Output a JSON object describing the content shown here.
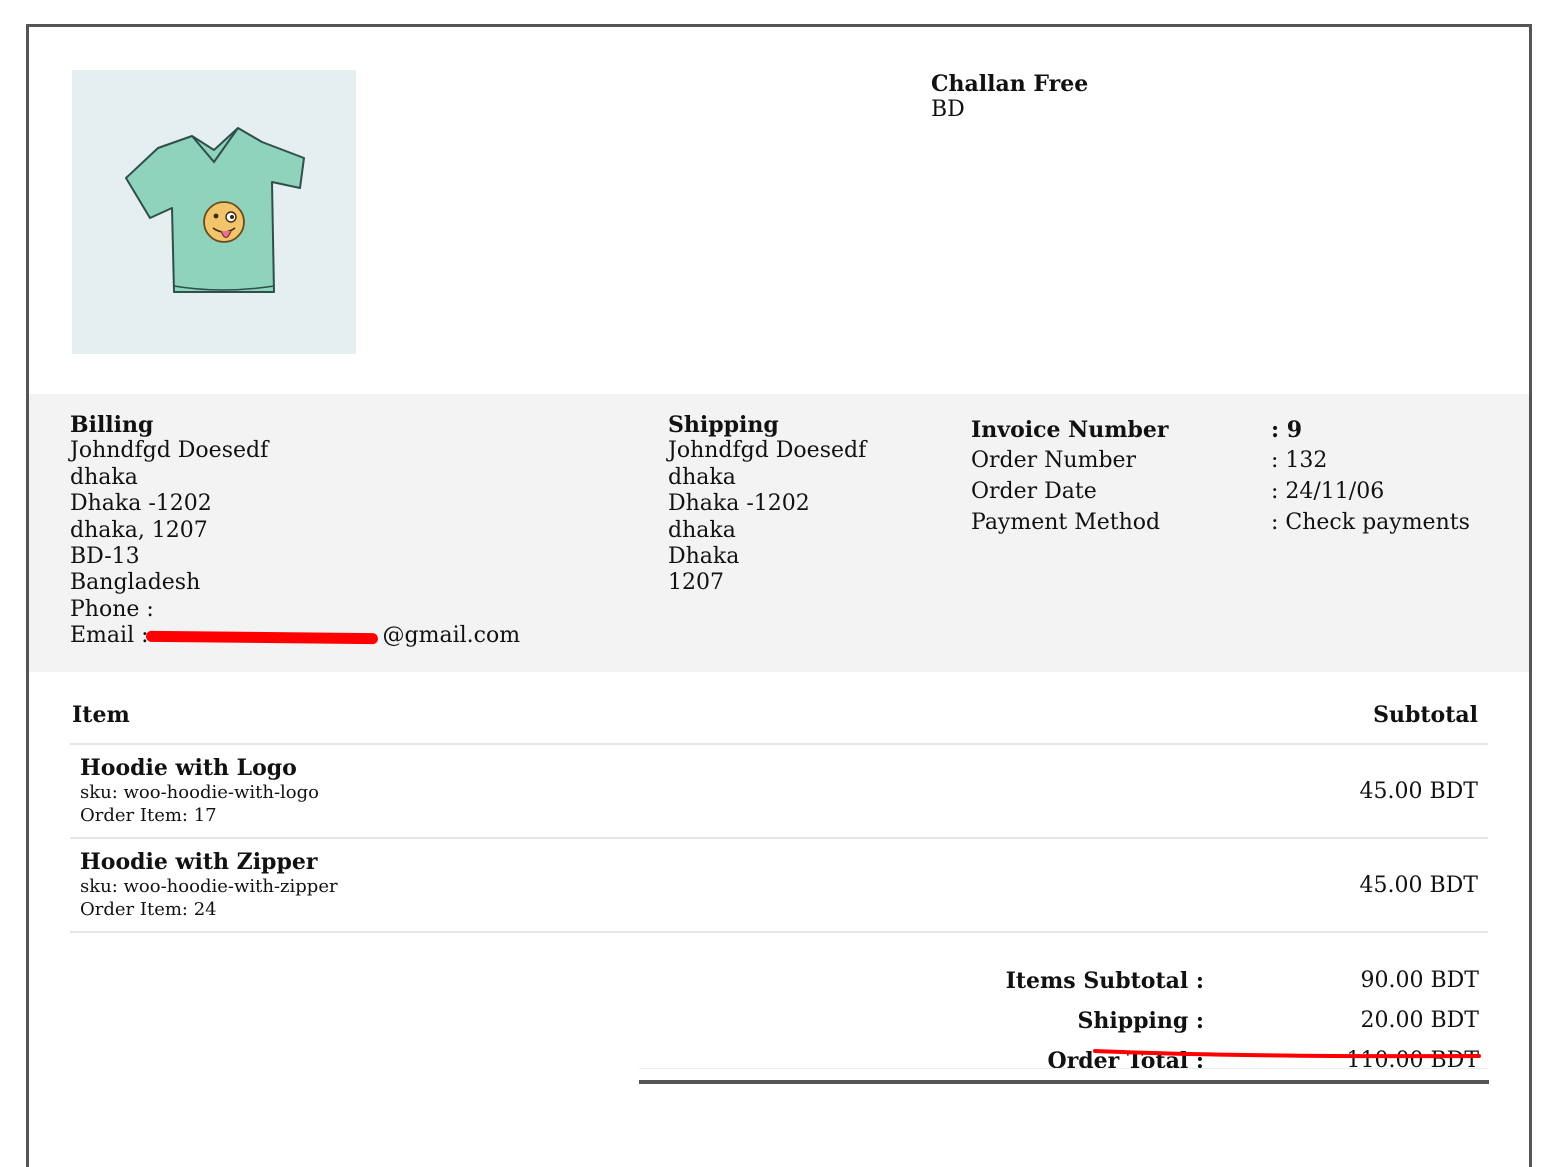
{
  "shop": {
    "name": "Challan Free",
    "country": "BD"
  },
  "billing": {
    "heading": "Billing",
    "lines": [
      "Johndfgd Doesedf",
      "dhaka",
      "Dhaka -1202",
      "dhaka, 1207",
      "BD-13",
      "Bangladesh"
    ],
    "phone_label": "Phone :",
    "email_label": "Email :",
    "email_visible_suffix": "@gmail.com"
  },
  "shipping": {
    "heading": "Shipping",
    "lines": [
      "Johndfgd Doesedf",
      "dhaka",
      "Dhaka -1202",
      "dhaka",
      "Dhaka",
      "1207"
    ]
  },
  "meta": {
    "invoice_number_label": "Invoice Number",
    "invoice_number": ": 9",
    "order_number_label": "Order Number",
    "order_number": ": 132",
    "order_date_label": "Order Date",
    "order_date": ": 24/11/06",
    "payment_method_label": "Payment Method",
    "payment_method": ": Check payments"
  },
  "items_table": {
    "col_item": "Item",
    "col_subtotal": "Subtotal",
    "rows": [
      {
        "title": "Hoodie with Logo",
        "sku": "sku: woo-hoodie-with-logo",
        "order_item": "Order Item: 17",
        "subtotal": "45.00 BDT"
      },
      {
        "title": "Hoodie with Zipper",
        "sku": "sku: woo-hoodie-with-zipper",
        "order_item": "Order Item: 24",
        "subtotal": "45.00 BDT"
      }
    ]
  },
  "totals": {
    "items_subtotal_label": "Items Subtotal :",
    "items_subtotal": "90.00 BDT",
    "shipping_label": "Shipping :",
    "shipping": "20.00 BDT",
    "order_total_label": "Order Total :",
    "order_total": "110.00 BDT"
  },
  "colors": {
    "band": "#f3f3f3",
    "annotation_red": "#ff0000",
    "logo_bg": "#e6eff0"
  }
}
